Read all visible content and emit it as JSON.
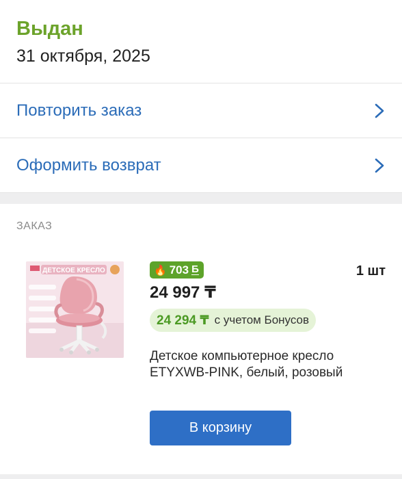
{
  "status": {
    "title": "Выдан",
    "date": "31 октября, 2025"
  },
  "actions": [
    {
      "label": "Повторить заказ",
      "icon": "chevron-right-icon"
    },
    {
      "label": "Оформить возврат",
      "icon": "chevron-right-icon"
    }
  ],
  "order": {
    "section_title": "ЗАКАЗ",
    "product": {
      "image_title": "ДЕТСКОЕ КРЕСЛО",
      "bonus_points": "703",
      "bonus_symbol": "Б",
      "price": "24 997 ₸",
      "quantity": "1 шт",
      "bonus_price": "24 294 ₸",
      "bonus_price_suffix": "с учетом Бонусов",
      "name": "Детское компьютерное кресло ETYXWB-PINK, белый, розовый",
      "cart_button": "В корзину"
    }
  },
  "colors": {
    "status_green": "#6ca32b",
    "link_blue": "#2b6cb8",
    "button_blue": "#2e6fc6",
    "badge_green": "#5da32a",
    "bonus_bg": "#e5f3d7"
  }
}
